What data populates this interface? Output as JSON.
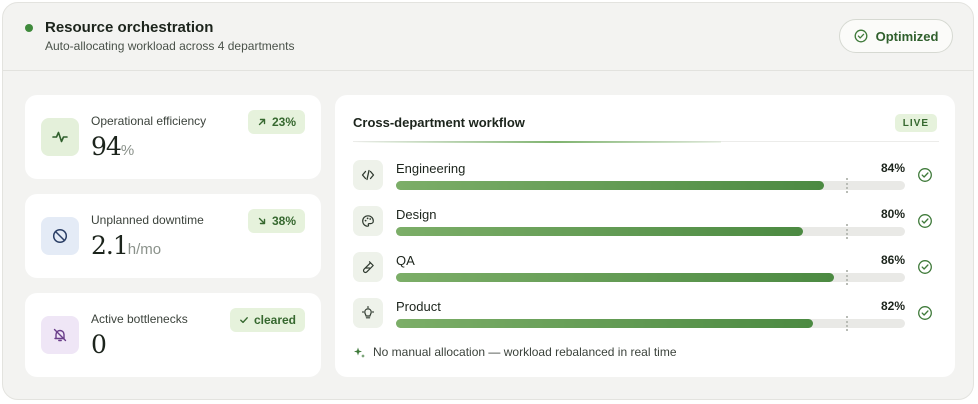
{
  "header": {
    "title": "Resource orchestration",
    "subtitle": "Auto-allocating workload across 4 departments",
    "status_button": "Optimized",
    "status_color": "#3f8a3c"
  },
  "metrics": [
    {
      "label": "Operational efficiency",
      "value": "94",
      "unit": "%",
      "badge": "23%",
      "badge_icon": "arrow-up-right-icon",
      "icon": "activity-pulse-icon"
    },
    {
      "label": "Unplanned downtime",
      "value": "2.1",
      "unit": "h/mo",
      "badge": "38%",
      "badge_icon": "arrow-down-right-icon",
      "icon": "slashed-circle-icon"
    },
    {
      "label": "Active bottlenecks",
      "value": "0",
      "unit": "",
      "badge": "cleared",
      "badge_icon": "check-icon",
      "icon": "bell-off-icon"
    }
  ],
  "workflow": {
    "title": "Cross-department workflow",
    "live_label": "LIVE",
    "target_fraction": 0.885,
    "departments": [
      {
        "name": "Engineering",
        "percent": "84%",
        "value": 0.84,
        "icon": "code-icon"
      },
      {
        "name": "Design",
        "percent": "80%",
        "value": 0.8,
        "icon": "palette-icon"
      },
      {
        "name": "QA",
        "percent": "86%",
        "value": 0.86,
        "icon": "test-tube-icon"
      },
      {
        "name": "Product",
        "percent": "82%",
        "value": 0.82,
        "icon": "lightbulb-icon"
      }
    ],
    "footnote": "No manual allocation — workload rebalanced in real time"
  },
  "colors": {
    "accent": "#4c8a42",
    "badge_bg": "#e6f2dc",
    "badge_text": "#36682f"
  }
}
